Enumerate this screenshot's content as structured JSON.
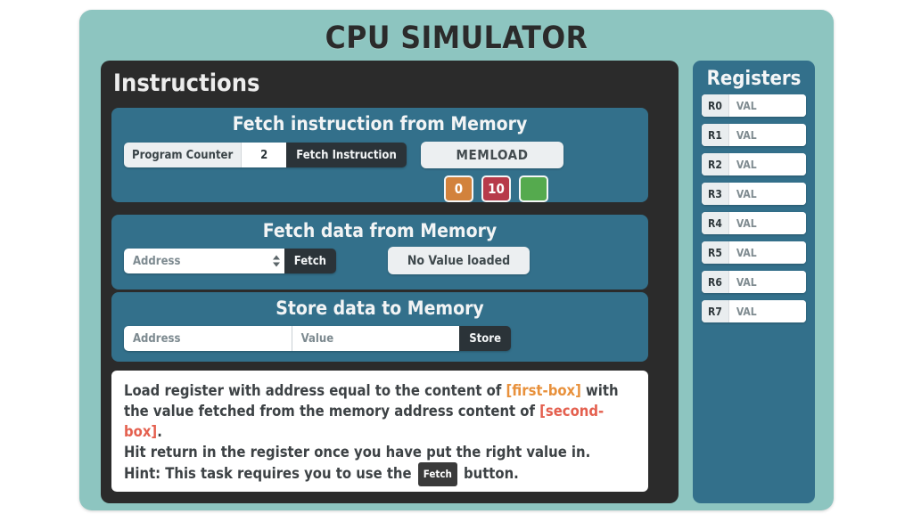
{
  "app": {
    "title": "CPU SIMULATOR",
    "colors": {
      "background": "#8dc5c0",
      "panel_dark": "#2b2b2b",
      "panel_blue": "#33708b",
      "button_dark": "#2b3338",
      "light": "#eceff1",
      "orange": "#d2823c",
      "red": "#b73a4a",
      "green": "#55aa4e",
      "token_orange": "#e8913c",
      "token_red": "#e4604f"
    }
  },
  "instructions": {
    "title": "Instructions",
    "fetch_instruction_section": {
      "title": "Fetch instruction from Memory",
      "program_counter_label": "Program Counter",
      "program_counter_value": "2",
      "fetch_instruction_label": "Fetch Instruction",
      "memload_label": "MEMLOAD",
      "boxes": [
        {
          "name": "opcode-box",
          "value": "0",
          "color": "#d2823c"
        },
        {
          "name": "operand-box",
          "value": "10",
          "color": "#b73a4a"
        },
        {
          "name": "result-box",
          "value": "",
          "color": "#55aa4e"
        }
      ]
    },
    "fetch_data_section": {
      "title": "Fetch data from Memory",
      "address_placeholder": "Address",
      "address_value": "",
      "fetch_label": "Fetch",
      "value_display": "No Value loaded"
    },
    "store_data_section": {
      "title": "Store data to Memory",
      "address_placeholder": "Address",
      "address_value": "",
      "value_placeholder": "Value",
      "value_value": "",
      "store_label": "Store"
    },
    "task": {
      "line1_part1": "Load register with address equal to the content of ",
      "line1_token1": "[first-box]",
      "line1_part2": " with the value fetched from the memory address content of ",
      "line1_token2": "[second-box]",
      "line1_part3": ".",
      "line2": "Hit return in the register once you have put the right value in.",
      "line3_part1": "Hint: This task requires you to use the ",
      "line3_badge": "Fetch",
      "line3_part2": " button."
    }
  },
  "registers": {
    "title": "Registers",
    "value_placeholder": "VAL",
    "items": [
      {
        "label": "R0",
        "value": ""
      },
      {
        "label": "R1",
        "value": ""
      },
      {
        "label": "R2",
        "value": ""
      },
      {
        "label": "R3",
        "value": ""
      },
      {
        "label": "R4",
        "value": ""
      },
      {
        "label": "R5",
        "value": ""
      },
      {
        "label": "R6",
        "value": ""
      },
      {
        "label": "R7",
        "value": ""
      }
    ]
  }
}
